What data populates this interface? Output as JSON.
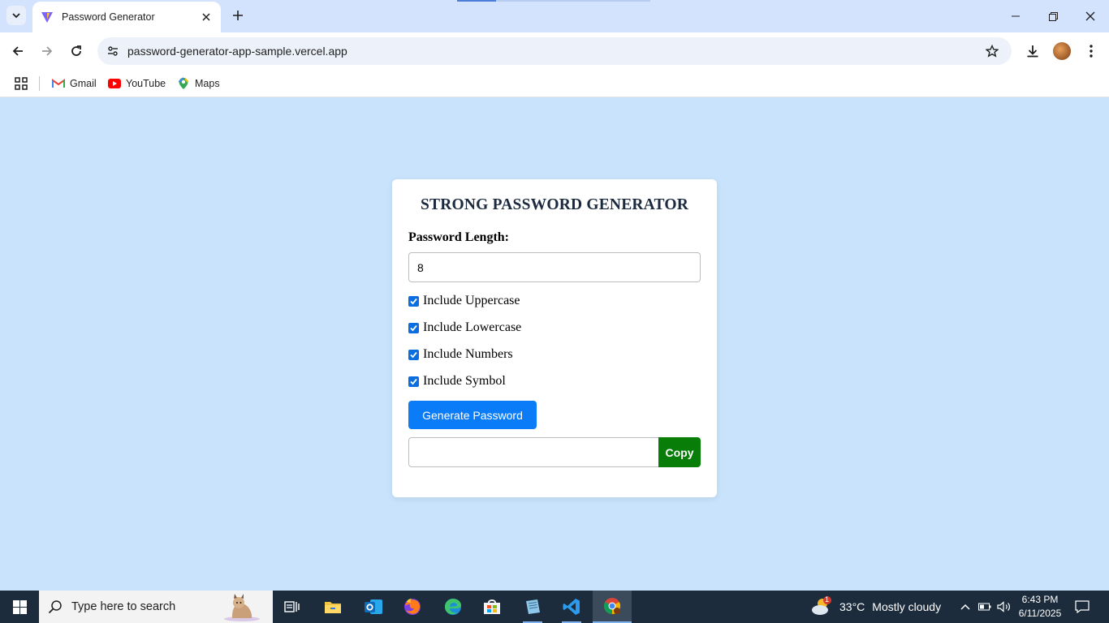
{
  "browser": {
    "tab": {
      "title": "Password Generator"
    },
    "url": "password-generator-app-sample.vercel.app",
    "bookmarks": [
      {
        "label": "Gmail",
        "icon": "gmail-icon"
      },
      {
        "label": "YouTube",
        "icon": "youtube-icon"
      },
      {
        "label": "Maps",
        "icon": "maps-icon"
      }
    ]
  },
  "app": {
    "title": "STRONG PASSWORD GENERATOR",
    "length_label": "Password Length:",
    "length_value": "8",
    "options": [
      {
        "label": "Include Uppercase",
        "checked": true
      },
      {
        "label": "Include Lowercase",
        "checked": true
      },
      {
        "label": "Include Numbers",
        "checked": true
      },
      {
        "label": "Include Symbol",
        "checked": true
      }
    ],
    "generate_label": "Generate Password",
    "output_value": "",
    "copy_label": "Copy",
    "colors": {
      "background": "#c8e3fb",
      "primary": "#0b7cf7",
      "copy": "#087e08"
    }
  },
  "taskbar": {
    "search_placeholder": "Type here to search",
    "weather": {
      "temp": "33°C",
      "condition": "Mostly cloudy",
      "alert_count": "1"
    },
    "time": "6:43 PM",
    "date": "6/11/2025"
  }
}
